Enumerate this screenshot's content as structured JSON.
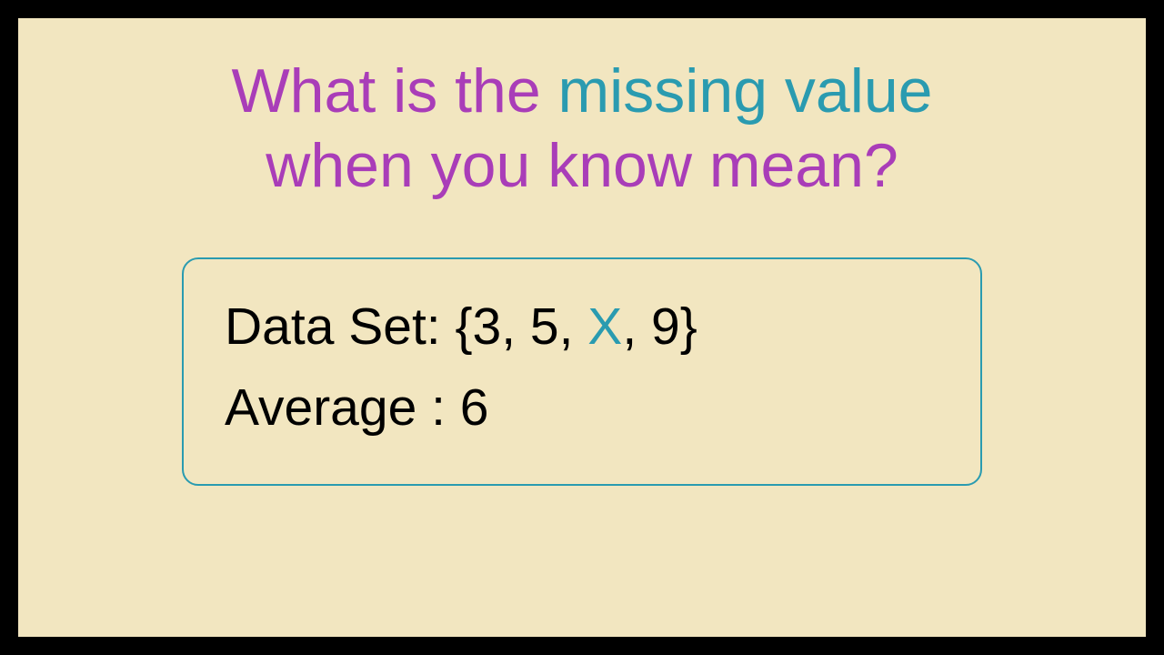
{
  "title": {
    "line1_part1": "What is the ",
    "line1_part2": "missing value",
    "line2": "when you know mean?"
  },
  "box": {
    "dataset_label": "Data Set: ",
    "dataset_open": "{",
    "dataset_v1": "3",
    "dataset_sep1": ",  ",
    "dataset_v2": "5",
    "dataset_sep2": ",  ",
    "dataset_x": "X",
    "dataset_sep3": ",  ",
    "dataset_v3": "9",
    "dataset_close": "}",
    "average_label": "Average : ",
    "average_value": "6"
  }
}
